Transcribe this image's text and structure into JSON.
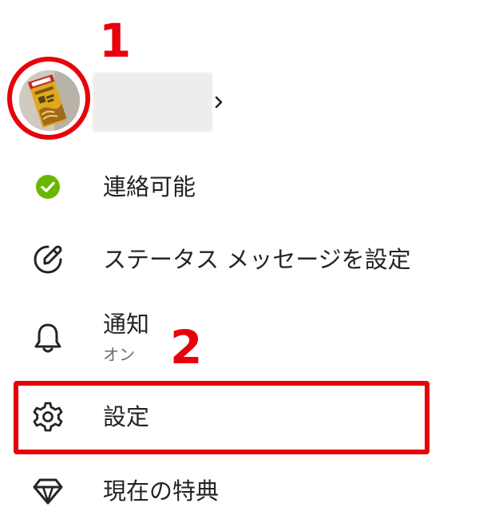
{
  "profile": {
    "avatar_icon": "profile-photo",
    "chevron_icon": "chevron-right-icon"
  },
  "menu": {
    "items": [
      {
        "label": "連絡可能",
        "icon": "available-status-icon",
        "icon_color": "#6bb700"
      },
      {
        "label": "ステータス メッセージを設定",
        "icon": "edit-status-icon"
      },
      {
        "label": "通知",
        "sublabel": "オン",
        "icon": "bell-icon"
      },
      {
        "label": "設定",
        "icon": "gear-icon"
      },
      {
        "label": "現在の特典",
        "icon": "diamond-icon"
      }
    ]
  },
  "annotations": {
    "step1": "1",
    "step2": "2",
    "color": "#e8000b"
  }
}
